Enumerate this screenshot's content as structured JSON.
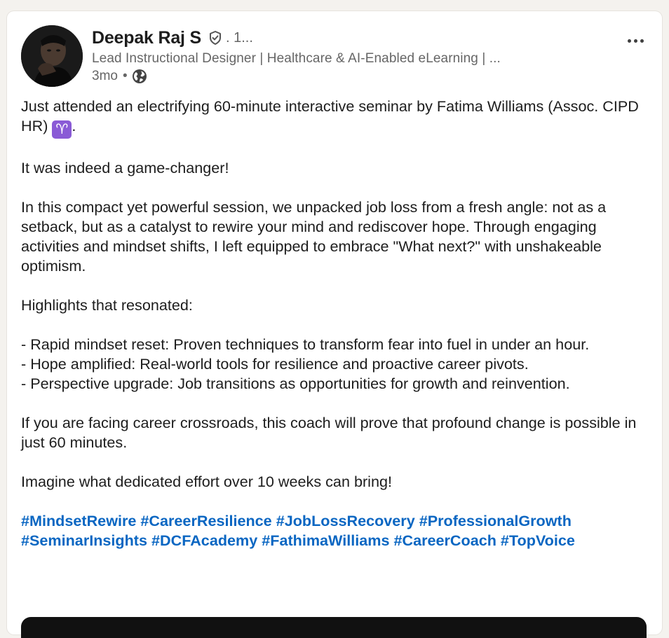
{
  "post": {
    "author": {
      "name": "Deepak Raj S",
      "connection": ". 1...",
      "headline": "Lead Instructional Designer | Healthcare & AI-Enabled eLearning | ...",
      "time": "3mo",
      "separator": "•",
      "visibility_icon": "globe-icon",
      "verified_icon": "shield-check-icon"
    },
    "more_icon": "more-horizontal-icon",
    "paragraphs": {
      "p1_text": "Just attended an electrifying 60-minute interactive seminar by Fatima Williams (Assoc. CIPD HR) ",
      "p1_emoji": "♈",
      "p1_end": ".",
      "p2": "It was indeed a game-changer!",
      "p3": "In this compact yet powerful session, we unpacked job loss from a fresh angle: not as a setback, but as a catalyst to rewire your mind and rediscover hope. Through engaging activities and mindset shifts, I left equipped to embrace \"What next?\" with unshakeable optimism.",
      "p4": "Highlights that resonated:",
      "bullets": [
        "- Rapid mindset reset: Proven techniques to  transform fear into fuel in under an hour.",
        "- Hope amplified: Real-world tools for resilience and proactive career pivots.",
        "- Perspective upgrade: Job transitions as opportunities for growth and reinvention."
      ],
      "p5": "If you are facing career crossroads, this coach will prove that profound change is possible in just 60 minutes.",
      "p6": "Imagine what dedicated effort over 10 weeks can bring!"
    },
    "hashtags": [
      "#MindsetRewire",
      "#CareerResilience",
      "#JobLossRecovery",
      "#ProfessionalGrowth",
      "#SeminarInsights",
      "#DCFAcademy",
      "#FathimaWilliams",
      "#CareerCoach",
      "#TopVoice"
    ]
  },
  "colors": {
    "link": "#0a66c2",
    "text": "#1d1d1d",
    "muted": "#666666",
    "background": "#f4f2ee",
    "card": "#ffffff"
  }
}
